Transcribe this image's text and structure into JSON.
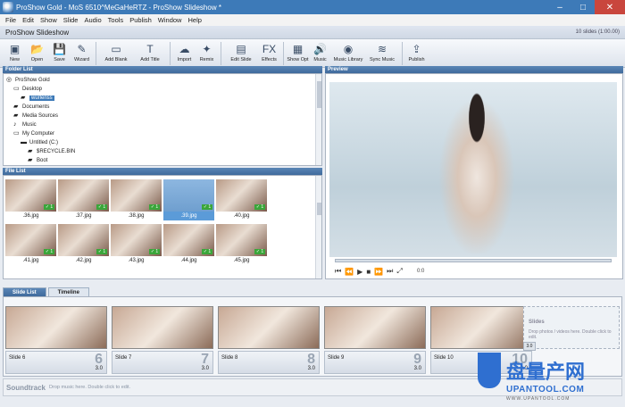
{
  "window": {
    "title": "ProShow Gold - MoS 6510^MeGaHeRTZ - ProShow Slideshow *",
    "minimize": "–",
    "maximize": "□",
    "close": "✕"
  },
  "menu": [
    "File",
    "Edit",
    "Show",
    "Slide",
    "Audio",
    "Tools",
    "Publish",
    "Window",
    "Help"
  ],
  "header": {
    "title": "ProShow Slideshow",
    "slide_count": "10 slides (1:00.00)"
  },
  "toolbar": [
    {
      "label": "New",
      "icon": "new-icon",
      "glyph": "▣"
    },
    {
      "label": "Open",
      "icon": "open-folder-icon",
      "glyph": "📂"
    },
    {
      "label": "Save",
      "icon": "save-icon",
      "glyph": "💾"
    },
    {
      "label": "Wizard",
      "icon": "wizard-icon",
      "glyph": "✎"
    },
    {
      "label": "Add Blank",
      "icon": "add-blank-icon",
      "glyph": "▭"
    },
    {
      "label": "Add Title",
      "icon": "add-title-icon",
      "glyph": "T"
    },
    {
      "label": "Import",
      "icon": "import-icon",
      "glyph": "☁"
    },
    {
      "label": "Remix",
      "icon": "remix-icon",
      "glyph": "✦"
    },
    {
      "label": "Edit Slide",
      "icon": "edit-slide-icon",
      "glyph": "▤"
    },
    {
      "label": "Effects",
      "icon": "effects-icon",
      "glyph": "FX"
    },
    {
      "label": "Show Opt",
      "icon": "show-options-icon",
      "glyph": "▦"
    },
    {
      "label": "Music",
      "icon": "music-icon",
      "glyph": "🔊"
    },
    {
      "label": "Music Library",
      "icon": "music-library-icon",
      "glyph": "◉"
    },
    {
      "label": "Sync Music",
      "icon": "sync-music-icon",
      "glyph": "≋"
    },
    {
      "label": "Publish",
      "icon": "publish-icon",
      "glyph": "⇪"
    }
  ],
  "folder_list": {
    "title": "Folder List",
    "items": [
      {
        "label": "ProShow Gold",
        "icon": "proshow-icon",
        "glyph": "◎",
        "indent": 0
      },
      {
        "label": "Desktop",
        "icon": "desktop-icon",
        "glyph": "▭",
        "indent": 1
      },
      {
        "label": "wurlenss",
        "icon": "folder-icon",
        "glyph": "▰",
        "indent": 2,
        "selected": true
      },
      {
        "label": "Documents",
        "icon": "folder-icon",
        "glyph": "▰",
        "indent": 1
      },
      {
        "label": "Media Sources",
        "icon": "folder-icon",
        "glyph": "▰",
        "indent": 1
      },
      {
        "label": "Music",
        "icon": "folder-icon",
        "glyph": "♪",
        "indent": 1
      },
      {
        "label": "My Computer",
        "icon": "computer-icon",
        "glyph": "▭",
        "indent": 1
      },
      {
        "label": "Untitled (C:)",
        "icon": "drive-icon",
        "glyph": "▬",
        "indent": 2
      },
      {
        "label": "$RECYCLE.BIN",
        "icon": "folder-icon",
        "glyph": "▰",
        "indent": 3
      },
      {
        "label": "Boot",
        "icon": "folder-icon",
        "glyph": "▰",
        "indent": 3
      }
    ]
  },
  "file_list": {
    "title": "File List",
    "files": [
      {
        "name": ".36.jpg"
      },
      {
        "name": ".37.jpg"
      },
      {
        "name": ".38.jpg"
      },
      {
        "name": ".39.jpg",
        "selected": true
      },
      {
        "name": ".40.jpg"
      },
      {
        "name": ".41.jpg"
      },
      {
        "name": ".42.jpg"
      },
      {
        "name": ".43.jpg"
      },
      {
        "name": ".44.jpg"
      },
      {
        "name": ".45.jpg"
      }
    ],
    "check": "✓ 1"
  },
  "preview": {
    "title": "Preview",
    "time": "0:0"
  },
  "tabs": {
    "slide_list": "Slide List",
    "timeline": "Timeline"
  },
  "slides": [
    {
      "name": "Slide 6",
      "number": "6",
      "duration": "3.0"
    },
    {
      "name": "Slide 7",
      "number": "7",
      "duration": "3.0"
    },
    {
      "name": "Slide 8",
      "number": "8",
      "duration": "3.0"
    },
    {
      "name": "Slide 9",
      "number": "9",
      "duration": "3.0"
    },
    {
      "name": "Slide 10",
      "number": "10",
      "duration": "3.0"
    }
  ],
  "drop_slot": {
    "title": "Slides",
    "hint": "Drop photos / videos here. Double click to edit.",
    "duration": "3.0"
  },
  "soundtrack": {
    "title": "Soundtrack",
    "hint": "Drop music here.  Double click to edit."
  },
  "watermark": {
    "brand_cn": "盘量产网",
    "brand_en": "UPANTOOL.COM",
    "sub": "WWW.UPANTOOL.COM"
  },
  "colors": {
    "titlebar": "#3d7ab8",
    "panel_header": "#4a76a8",
    "check": "#3aa63a",
    "close": "#c9463d"
  }
}
